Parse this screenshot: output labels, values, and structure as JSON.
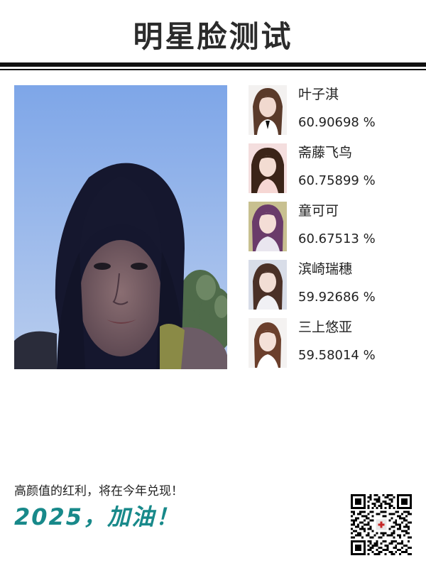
{
  "header": {
    "title": "明星脸测试"
  },
  "matches": [
    {
      "name": "叶子淇",
      "score": "60.90698 %",
      "hair": "#5a3a2a",
      "bg": "#f3f1f0",
      "top": "#ffffff"
    },
    {
      "name": "斋藤飞鸟",
      "score": "60.75899 %",
      "hair": "#3b2418",
      "bg": "#f4dede",
      "top": "#f6d7d4"
    },
    {
      "name": "童可可",
      "score": "60.67513 %",
      "hair": "#6a3b6a",
      "bg": "#c8c090",
      "top": "#e9e6ef"
    },
    {
      "name": "滨崎瑞穗",
      "score": "59.92686 %",
      "hair": "#4a3026",
      "bg": "#d8dde8",
      "top": "#f0f0f4"
    },
    {
      "name": "三上悠亚",
      "score": "59.58014 %",
      "hair": "#6b3f2c",
      "bg": "#f4f2f1",
      "top": "#ffffff"
    }
  ],
  "footer": {
    "slogan": "高颜值的红利，将在今年兑现！",
    "cheer": "2025，加油！"
  },
  "colors": {
    "accent": "#18898a",
    "title": "#2b2b2b",
    "rule": "#111111",
    "sky_top": "#7fa6e6",
    "sky_bottom": "#b7cbec"
  }
}
